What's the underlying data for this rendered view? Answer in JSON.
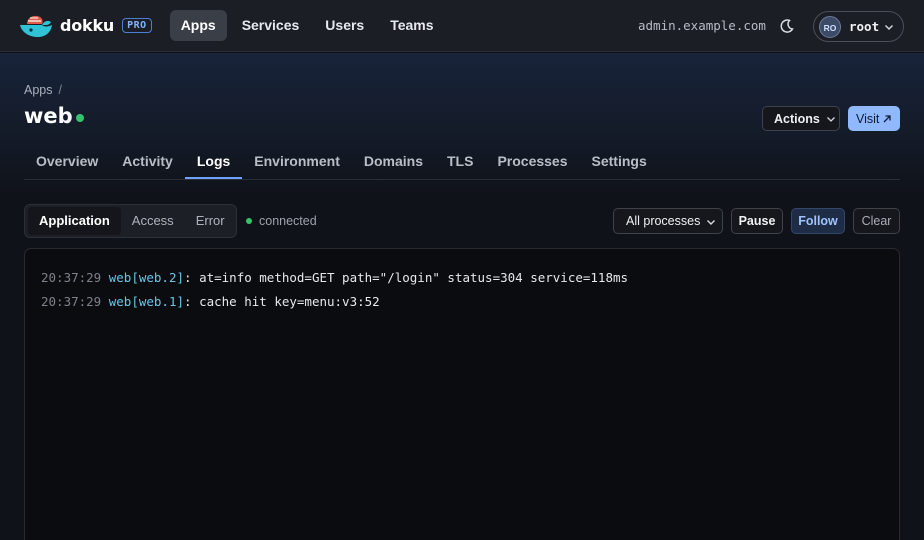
{
  "brand": {
    "name": "dokku",
    "badge": "PRO"
  },
  "nav": [
    {
      "label": "Apps",
      "active": true
    },
    {
      "label": "Services",
      "active": false
    },
    {
      "label": "Users",
      "active": false
    },
    {
      "label": "Teams",
      "active": false
    }
  ],
  "header": {
    "host": "admin.example.com",
    "user_initials": "RO",
    "user_name": "root"
  },
  "breadcrumb": {
    "root": "Apps",
    "separator": "/"
  },
  "app": {
    "name": "web",
    "status_color": "#36c46b"
  },
  "actions": {
    "actions_label": "Actions",
    "visit_label": "Visit"
  },
  "tabs": [
    {
      "label": "Overview",
      "active": false
    },
    {
      "label": "Activity",
      "active": false
    },
    {
      "label": "Logs",
      "active": true
    },
    {
      "label": "Environment",
      "active": false
    },
    {
      "label": "Domains",
      "active": false
    },
    {
      "label": "TLS",
      "active": false
    },
    {
      "label": "Processes",
      "active": false
    },
    {
      "label": "Settings",
      "active": false
    }
  ],
  "log_filters": [
    {
      "label": "Application",
      "active": true
    },
    {
      "label": "Access",
      "active": false
    },
    {
      "label": "Error",
      "active": false
    }
  ],
  "connection": {
    "status": "connected"
  },
  "controls": {
    "process_select": "All processes",
    "pause_label": "Pause",
    "follow_label": "Follow",
    "clear_label": "Clear"
  },
  "logs": [
    {
      "time": "20:37:29",
      "source": "web[web.2]",
      "message": ": at=info method=GET path=\"/login\" status=304 service=118ms"
    },
    {
      "time": "20:37:29",
      "source": "web[web.1]",
      "message": ": cache hit key=menu:v3:52"
    }
  ],
  "colors": {
    "accent": "#8fb8ff",
    "link_blue": "#6ea2ff",
    "success": "#36c46b",
    "log_source": "#67c6e6"
  }
}
